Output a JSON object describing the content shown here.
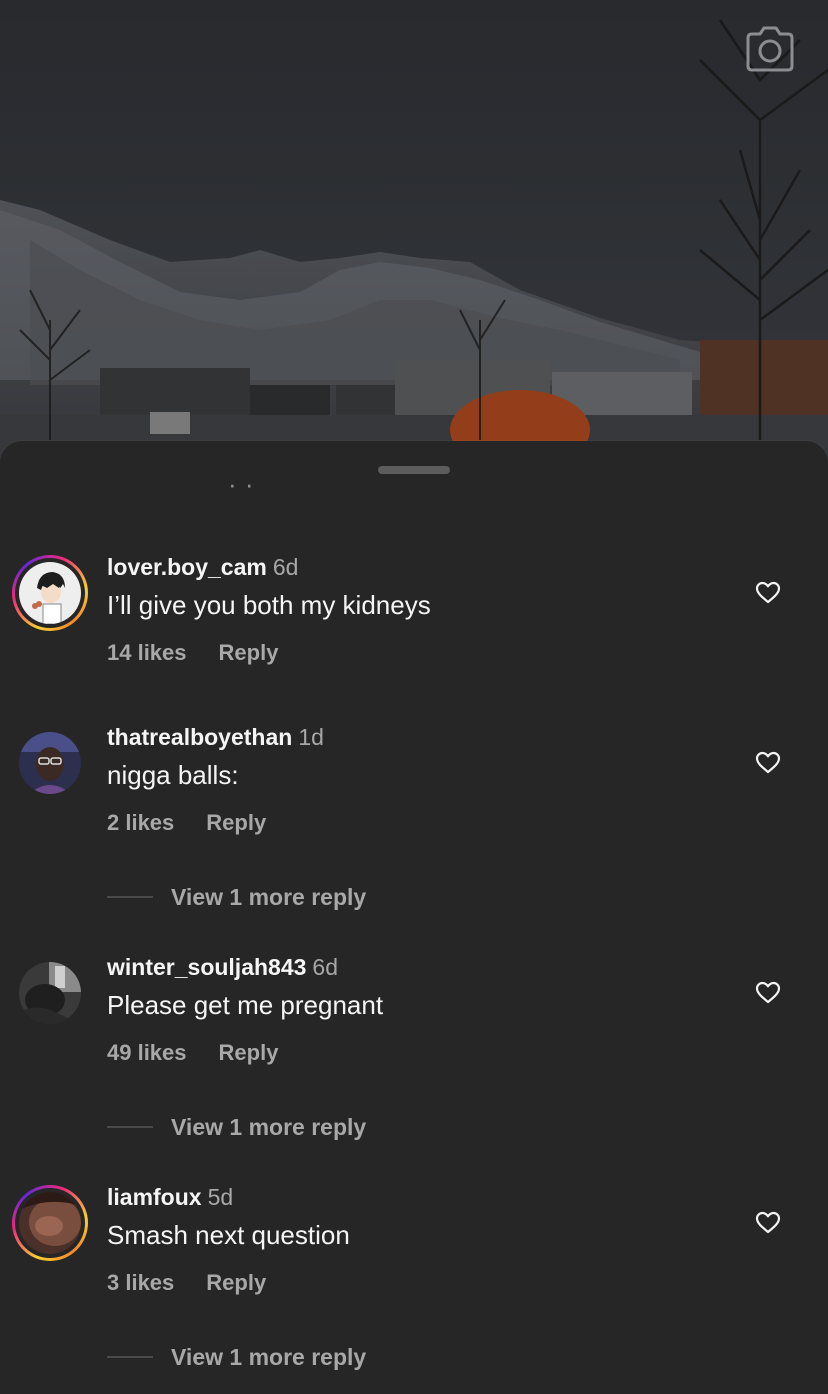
{
  "colors": {
    "background": "#262626",
    "primary_text": "#f5f5f5",
    "secondary_text": "#a8a8a8",
    "heart_outline": "#f5f5f5",
    "grabber": "#5c5c5c"
  },
  "header": {
    "camera_icon": "camera-icon",
    "clipped_previous_reply_text": "· ·"
  },
  "comments": [
    {
      "username": "lover.boy_cam",
      "time": "6d",
      "text": "I’ll give you both my kidneys",
      "likes": "14 likes",
      "reply_label": "Reply",
      "has_story_ring": true,
      "like_icon": "heart-outline-icon"
    },
    {
      "username": "thatrealboyethan",
      "time": "1d",
      "text": "nigga balls:",
      "likes": "2 likes",
      "reply_label": "Reply",
      "has_story_ring": false,
      "like_icon": "heart-outline-icon",
      "view_more": "View 1 more reply"
    },
    {
      "username": "winter_souljah843",
      "time": "6d",
      "text": "Please get me pregnant",
      "likes": "49 likes",
      "reply_label": "Reply",
      "has_story_ring": false,
      "like_icon": "heart-outline-icon",
      "view_more": "View 1 more reply"
    },
    {
      "username": "liamfoux",
      "time": "5d",
      "text": "Smash next question",
      "likes": "3 likes",
      "reply_label": "Reply",
      "has_story_ring": true,
      "like_icon": "heart-outline-icon",
      "view_more": "View 1 more reply"
    }
  ]
}
